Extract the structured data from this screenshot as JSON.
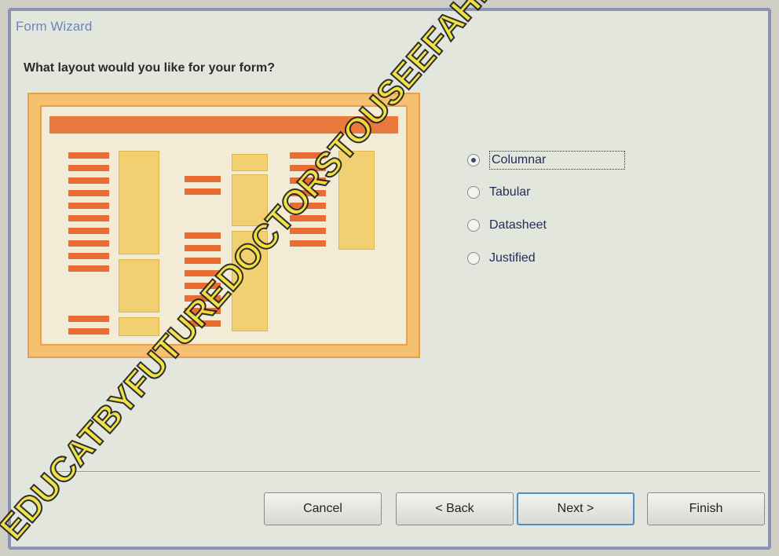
{
  "window": {
    "title": "Form Wizard",
    "question": "What layout would you like for your form?"
  },
  "layout_options": [
    {
      "label": "Columnar",
      "selected": true
    },
    {
      "label": "Tabular",
      "selected": false
    },
    {
      "label": "Datasheet",
      "selected": false
    },
    {
      "label": "Justified",
      "selected": false
    }
  ],
  "buttons": {
    "cancel": "Cancel",
    "back": "< Back",
    "next": "Next >",
    "finish": "Finish"
  },
  "watermark": "EDUCATBYFUTUREDOCTORSTOUSEEFAHMAD",
  "colors": {
    "preview_header": "#e9793c",
    "preview_label": "#e86d35",
    "preview_field": "#f0d070",
    "title_text": "#6d86b9",
    "default_button_border": "#4f8fc8"
  }
}
